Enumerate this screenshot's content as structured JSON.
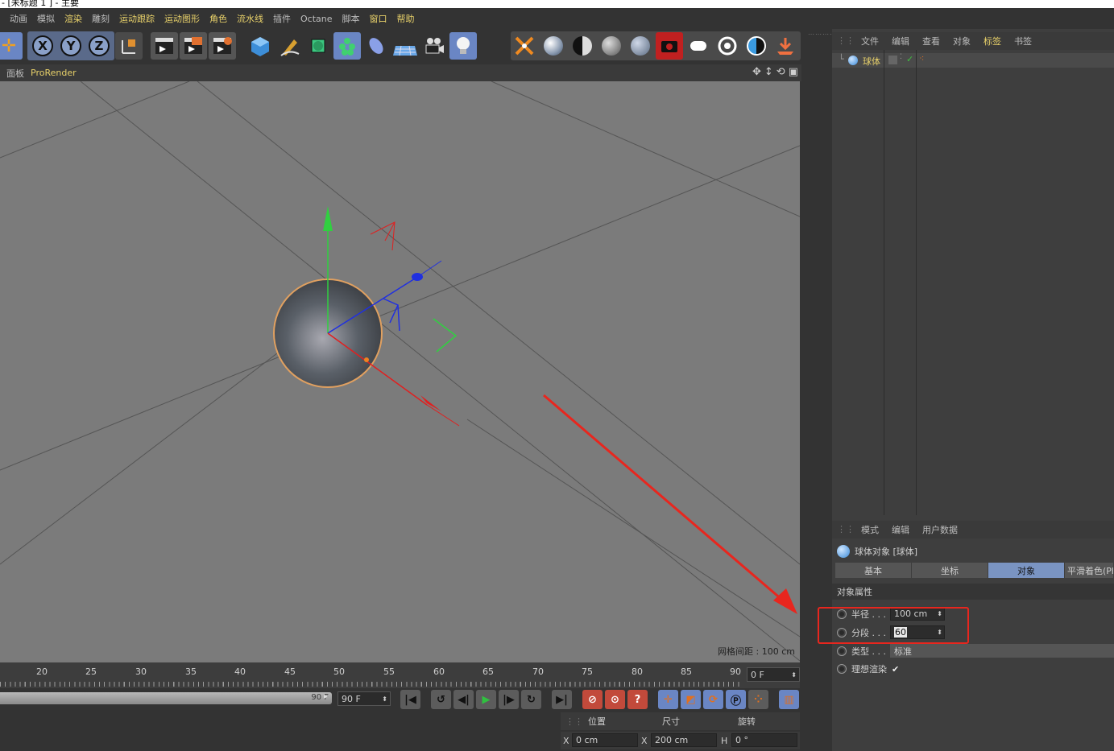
{
  "window": {
    "title": "- [未标题 1 ] - 主要"
  },
  "menu": {
    "items": [
      {
        "label": "动画",
        "hi": false
      },
      {
        "label": "模拟",
        "hi": false
      },
      {
        "label": "渲染",
        "hi": true
      },
      {
        "label": "雕刻",
        "hi": false
      },
      {
        "label": "运动跟踪",
        "hi": true
      },
      {
        "label": "运动图形",
        "hi": true
      },
      {
        "label": "角色",
        "hi": true
      },
      {
        "label": "流水线",
        "hi": true
      },
      {
        "label": "插件",
        "hi": false
      },
      {
        "label": "Octane",
        "hi": false
      },
      {
        "label": "脚本",
        "hi": false
      },
      {
        "label": "窗口",
        "hi": true
      },
      {
        "label": "帮助",
        "hi": true
      }
    ]
  },
  "toolbar": {
    "axis_x": "X",
    "axis_y": "Y",
    "axis_z": "Z"
  },
  "viewport": {
    "menu_panel": "面板",
    "menu_prorender": "ProRender",
    "grid_spacing": "网格间距 : 100 cm"
  },
  "timeline": {
    "ruler": [
      "20",
      "25",
      "30",
      "35",
      "40",
      "45",
      "50",
      "55",
      "60",
      "65",
      "70",
      "75",
      "80",
      "85",
      "90"
    ],
    "current_frame": "0 F",
    "slider_end": "90 F",
    "end_frame": "90 F"
  },
  "coords": {
    "position_label": "位置",
    "size_label": "尺寸",
    "rotation_label": "旋转",
    "x_label": "X",
    "x_value": "0 cm",
    "sx_label": "X",
    "sx_value": "200 cm",
    "h_label": "H",
    "h_value": "0 °"
  },
  "object_manager": {
    "menu": [
      {
        "label": "文件",
        "hi": false
      },
      {
        "label": "编辑",
        "hi": false
      },
      {
        "label": "查看",
        "hi": false
      },
      {
        "label": "对象",
        "hi": false
      },
      {
        "label": "标签",
        "hi": true
      },
      {
        "label": "书签",
        "hi": false
      }
    ],
    "object_name": "球体"
  },
  "attributes": {
    "menu": [
      "模式",
      "编辑",
      "用户数据"
    ],
    "title": "球体对象 [球体]",
    "tabs": [
      {
        "label": "基本",
        "active": false
      },
      {
        "label": "坐标",
        "active": false
      },
      {
        "label": "对象",
        "active": true
      },
      {
        "label": "平滑着色(Ph",
        "active": false
      }
    ],
    "section": "对象属性",
    "radius_label": "半径 . . .",
    "radius_value": "100 cm",
    "segments_label": "分段 . . .",
    "segments_value": "60",
    "type_label": "类型 . . .",
    "type_value": "标准",
    "ideal_render_label": "理想渲染",
    "ideal_render_check": "✔"
  },
  "colors": {
    "highlight_text": "#e8d16a",
    "active_tab": "#7a94c2",
    "annotation": "#e8261e"
  }
}
